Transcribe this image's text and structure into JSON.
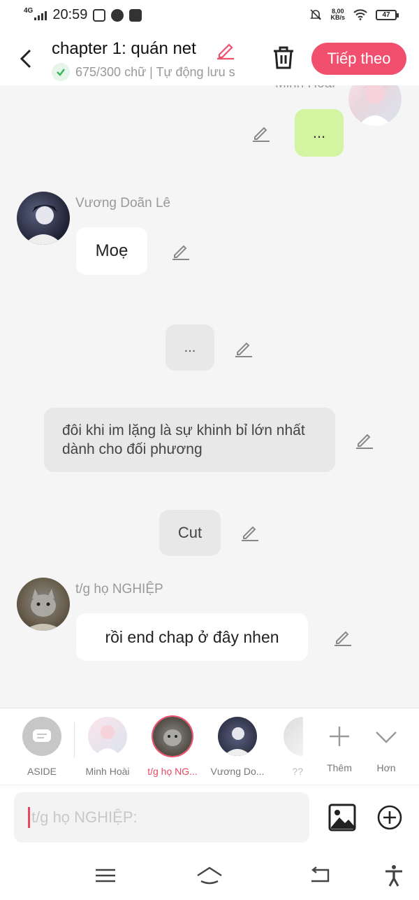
{
  "status_bar": {
    "network": "4G",
    "time": "20:59",
    "app_icons": [
      "zalo-icon",
      "speedometer-icon",
      "gallery-icon"
    ],
    "speed_value": "8,00",
    "speed_unit": "KB/s",
    "battery": "47"
  },
  "header": {
    "title": "chapter 1: quán net",
    "word_count": "675/300 chữ | Tự động lưu s",
    "next_label": "Tiếp theo",
    "accent": "#f0506e"
  },
  "messages": [
    {
      "kind": "right",
      "name": "Minh Hoài",
      "text": "...",
      "bubble": "green"
    },
    {
      "kind": "left",
      "name": "Vương Doãn Lê",
      "text": "Moẹ",
      "bubble": "white"
    },
    {
      "kind": "aside",
      "text": "..."
    },
    {
      "kind": "aside",
      "text": "đôi khi im lặng là sự khinh bỉ lớn nhất dành cho đối phương"
    },
    {
      "kind": "aside",
      "text": "Cut"
    },
    {
      "kind": "left",
      "name": "t/g họ NGHIỆP",
      "text": "rồi end chap ở đây nhen",
      "bubble": "white"
    }
  ],
  "character_bar": {
    "aside_label": "ASIDE",
    "characters": [
      {
        "name": "Minh Hoài",
        "active": false
      },
      {
        "name": "t/g họ NG...",
        "active": true
      },
      {
        "name": "Vương Do...",
        "active": false
      },
      {
        "name": "??",
        "active": false
      }
    ],
    "add_label": "Thêm",
    "more_label": "Hơn"
  },
  "composer": {
    "placeholder": "t/g họ NGHIỆP:"
  }
}
